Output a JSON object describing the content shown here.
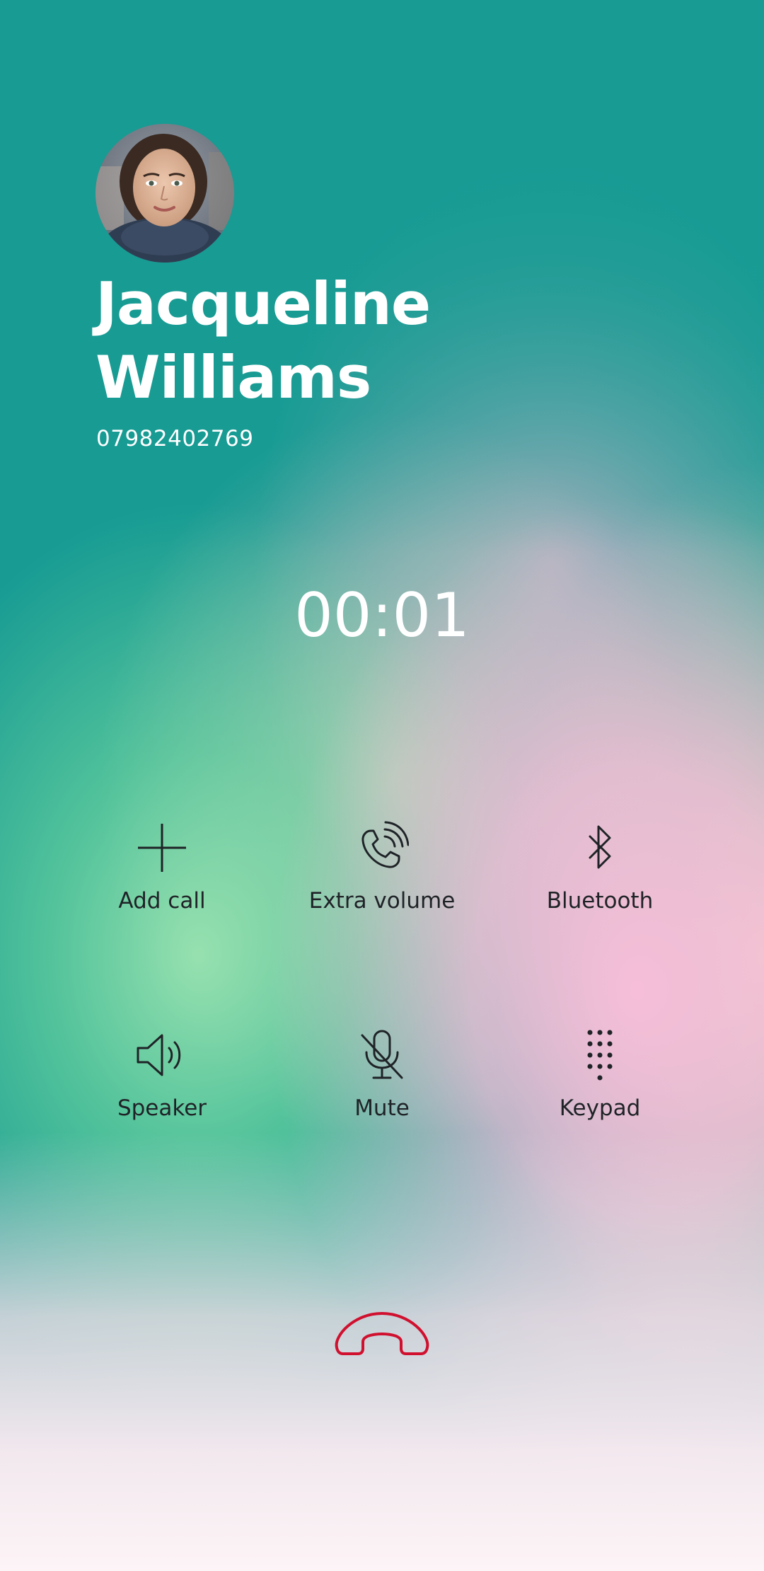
{
  "caller": {
    "first_name": "Jacqueline",
    "last_name": "Williams",
    "number": "07982402769"
  },
  "call": {
    "timer": "00:01"
  },
  "controls": {
    "add_call": "Add call",
    "extra_volume": "Extra volume",
    "bluetooth": "Bluetooth",
    "speaker": "Speaker",
    "mute": "Mute",
    "keypad": "Keypad"
  },
  "icons": {
    "add_call": "plus-icon",
    "extra_volume": "phone-volume-icon",
    "bluetooth": "bluetooth-icon",
    "speaker": "speaker-icon",
    "mute": "mic-off-icon",
    "keypad": "keypad-icon",
    "end_call": "end-call-icon"
  },
  "colors": {
    "background_top": "#179b93",
    "end_call": "#d0102e",
    "control_text": "#1f2327"
  }
}
